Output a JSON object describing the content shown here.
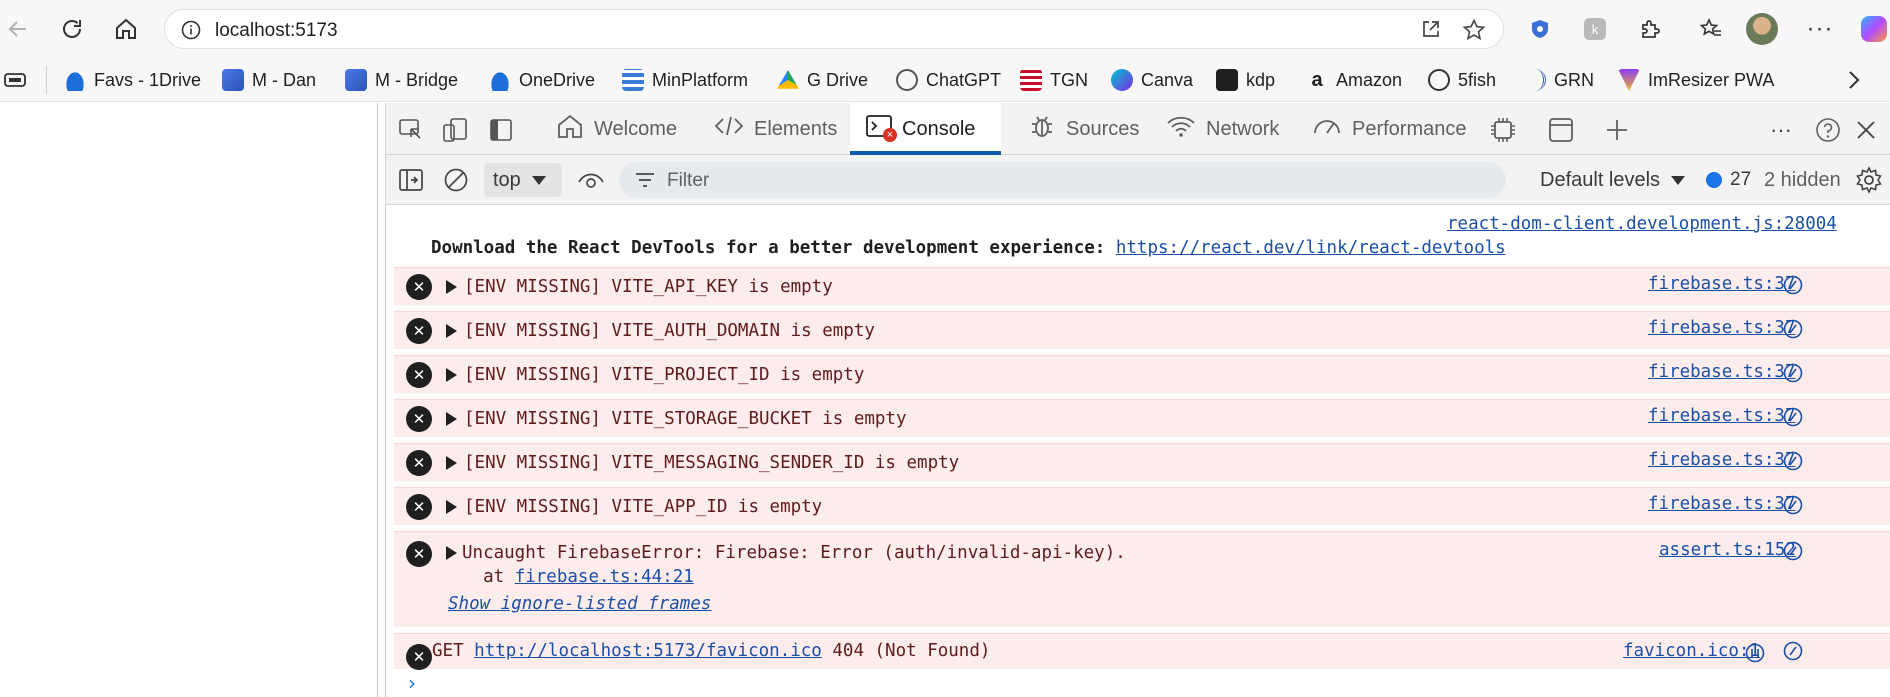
{
  "browser": {
    "url": "localhost:5173"
  },
  "favorites": [
    {
      "label": "Favs - 1Drive",
      "icon": "onedrive-cloud-icon"
    },
    {
      "label": "M - Dan",
      "icon": "workspace-icon"
    },
    {
      "label": "M - Bridge",
      "icon": "workspace-icon"
    },
    {
      "label": "OneDrive",
      "icon": "onedrive-cloud-icon"
    },
    {
      "label": "MinPlatform",
      "icon": "layers-icon"
    },
    {
      "label": "G Drive",
      "icon": "google-drive-icon"
    },
    {
      "label": "ChatGPT",
      "icon": "chatgpt-icon"
    },
    {
      "label": "TGN",
      "icon": "tgn-flag-icon"
    },
    {
      "label": "Canva",
      "icon": "canva-icon"
    },
    {
      "label": "kdp",
      "icon": "kdp-icon"
    },
    {
      "label": "Amazon",
      "icon": "amazon-icon"
    },
    {
      "label": "5fish",
      "icon": "globe-icon"
    },
    {
      "label": "GRN",
      "icon": "grn-icon"
    },
    {
      "label": "ImResizer PWA",
      "icon": "imresizer-icon"
    }
  ],
  "devtools": {
    "tabs": [
      {
        "label": "Welcome",
        "icon": "home-icon"
      },
      {
        "label": "Elements",
        "icon": "code-icon"
      },
      {
        "label": "Console",
        "icon": "console-icon",
        "active": true
      },
      {
        "label": "Sources",
        "icon": "bug-icon"
      },
      {
        "label": "Network",
        "icon": "wifi-icon"
      },
      {
        "label": "Performance",
        "icon": "gauge-icon"
      }
    ],
    "toolbar": {
      "context": "top",
      "filter_placeholder": "Filter",
      "levels": "Default levels",
      "issues_count": "27",
      "hidden": "2 hidden"
    },
    "console": {
      "info": {
        "source": "react-dom-client.development.js:28004",
        "text": "Download the React DevTools for a better development experience: ",
        "link": "https://react.dev/link/react-devtools"
      },
      "errors": [
        {
          "text": "[ENV MISSING] VITE_API_KEY is empty",
          "source": "firebase.ts:37"
        },
        {
          "text": "[ENV MISSING] VITE_AUTH_DOMAIN is empty",
          "source": "firebase.ts:37"
        },
        {
          "text": "[ENV MISSING] VITE_PROJECT_ID is empty",
          "source": "firebase.ts:37"
        },
        {
          "text": "[ENV MISSING] VITE_STORAGE_BUCKET is empty",
          "source": "firebase.ts:37"
        },
        {
          "text": "[ENV MISSING] VITE_MESSAGING_SENDER_ID is empty",
          "source": "firebase.ts:37"
        },
        {
          "text": "[ENV MISSING] VITE_APP_ID is empty",
          "source": "firebase.ts:37"
        }
      ],
      "uncaught": {
        "text": "Uncaught FirebaseError: Firebase: Error (auth/invalid-api-key).",
        "at_prefix": "  at ",
        "at_link": "firebase.ts:44:21",
        "show_frames": "Show ignore-listed frames",
        "source": "assert.ts:152"
      },
      "network_error": {
        "method": "GET ",
        "url": "http://localhost:5173/favicon.ico",
        "status": " 404 (Not Found)",
        "source": "favicon.ico:1"
      },
      "prompt": "›"
    }
  }
}
